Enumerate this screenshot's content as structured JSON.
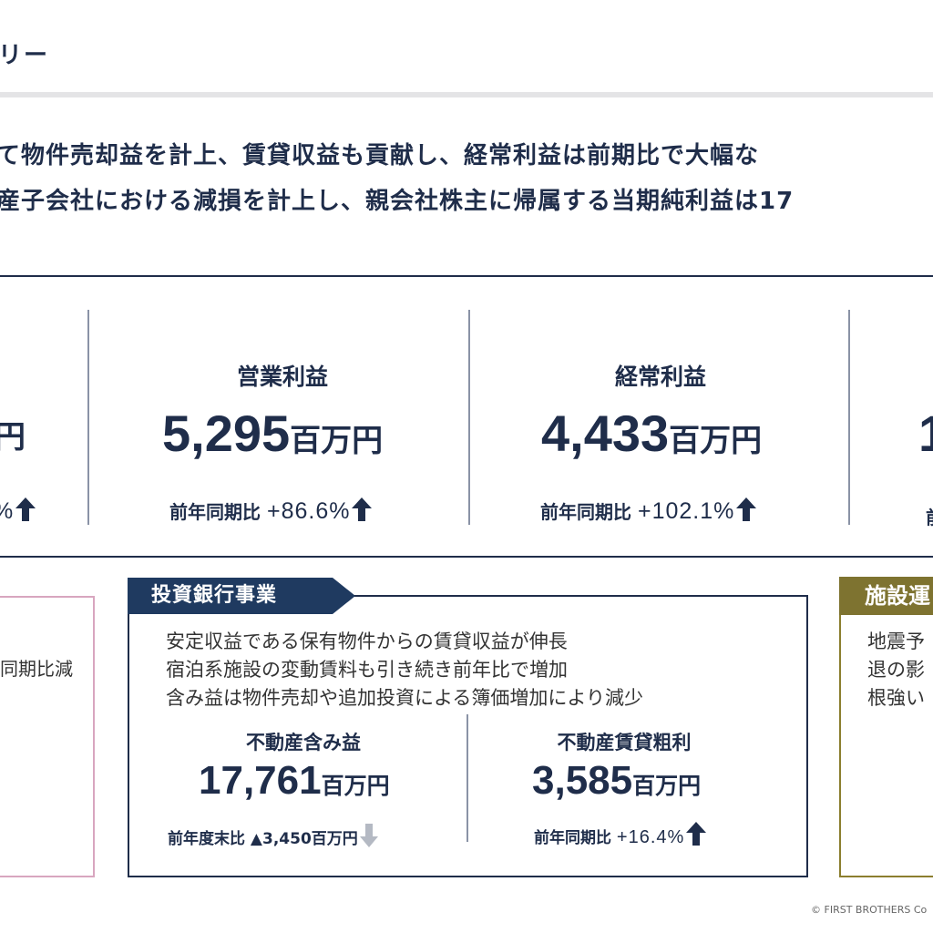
{
  "header": {
    "title": "リー"
  },
  "summary": {
    "line1": "て物件売却益を計上、賃貸収益も貢献し、経常利益は前期比で大幅な",
    "line2": "産子会社における減損を計上し、親会社株主に帰属する当期純利益は17"
  },
  "kpis": {
    "left_partial": {
      "unit": "円",
      "yoy_tail": "%"
    },
    "operating_income": {
      "label": "営業利益",
      "value": "5,295",
      "unit": "百万円",
      "yoy_label": "前年同期比",
      "yoy_value": "+86.6%",
      "trend": "up"
    },
    "ordinary_income": {
      "label": "経常利益",
      "value": "4,433",
      "unit": "百万円",
      "yoy_label": "前年同期比",
      "yoy_value": "+102.1%",
      "trend": "up"
    },
    "right_partial": {
      "value_head": "1",
      "yoy_head": "前"
    }
  },
  "segments": {
    "left_partial": {
      "text": "同期比減"
    },
    "investment_banking": {
      "tag": "投資銀行事業",
      "lines": [
        "安定収益である保有物件からの賃貸収益が伸長",
        "宿泊系施設の変動賃料も引き続き前年比で増加",
        "含み益は物件売却や追加投資による簿価増加により減少"
      ],
      "unrealized_gain": {
        "label": "不動産含み益",
        "value": "17,761",
        "unit": "百万円",
        "yoy_label": "前年度末比",
        "yoy_value": "▲3,450百万円",
        "trend": "down"
      },
      "rental_gross_profit": {
        "label": "不動産賃貸粗利",
        "value": "3,585",
        "unit": "百万円",
        "yoy_label": "前年同期比",
        "yoy_value": "+16.4%",
        "trend": "up"
      }
    },
    "facility_ops_partial": {
      "tag": "施設運",
      "lines": [
        "地震予",
        "退の影",
        "根強い"
      ]
    }
  },
  "footer": {
    "copyright": "© FIRST BROTHERS Co"
  },
  "colors": {
    "navy": "#1f2d4a",
    "tag_navy": "#1f3a60",
    "olive": "#7e7330",
    "pink": "#d8a6bf",
    "gray_arrow": "#b4b9c3"
  }
}
